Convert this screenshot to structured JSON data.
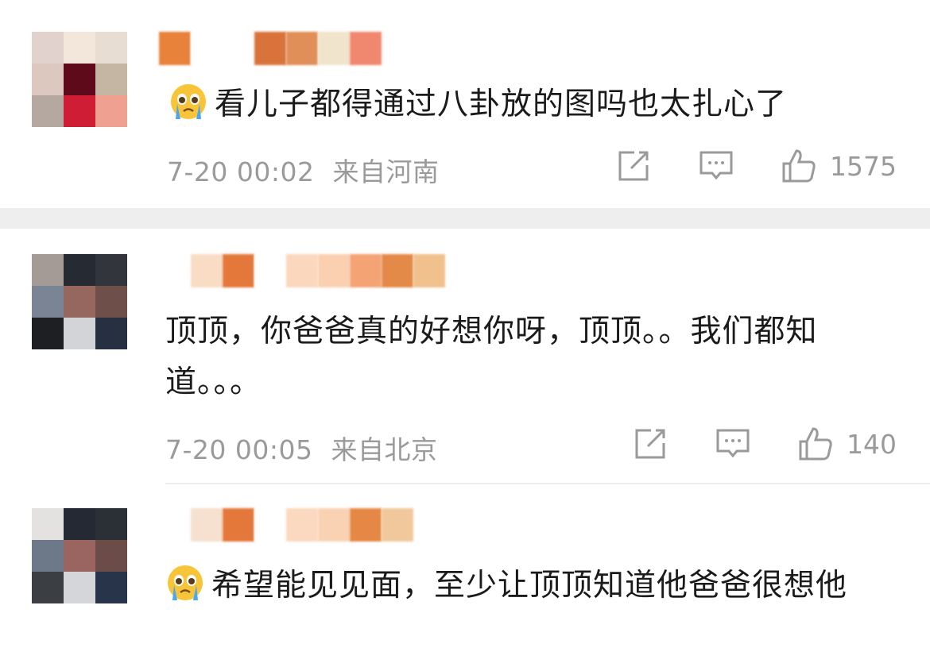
{
  "comments": [
    {
      "text": "看儿子都得通过八卦放的图吗也太扎心了",
      "has_emoji": true,
      "emoji_icon": "crying-face-icon",
      "time": "7-20 00:02",
      "location": "来自河南",
      "likes": "1575",
      "avatar_colors": [
        "#e2d2cd",
        "#f3e7dc",
        "#e8ddd2",
        "#dcc8bf",
        "#5e0a1a",
        "#c4b6a3",
        "#b4a8a0",
        "#cf1d36",
        "#f0a090"
      ],
      "name_blocks": [
        "#e8823a",
        "#ffffff",
        "#ffffff",
        "#d9733c",
        "#e08f58",
        "#f1e4cc",
        "#f08870"
      ]
    },
    {
      "text": "顶顶，你爸爸真的好想你呀，顶顶。。我们都知道。。。",
      "has_emoji": false,
      "time": "7-20 00:05",
      "location": "来自北京",
      "likes": "140",
      "avatar_colors": [
        "#a59b96",
        "#262a33",
        "#33353c",
        "#7b8494",
        "#95675e",
        "#6e4f4a",
        "#1d1f22",
        "#d3d4d8",
        "#263040"
      ],
      "name_blocks": [
        "#f9dcc4",
        "#e4783a",
        "#ffffff",
        "#fbd7bd",
        "#fad0b1",
        "#f4a374",
        "#e48a48",
        "#f0c18c"
      ]
    },
    {
      "text": "希望能见见面，至少让顶顶知道他爸爸很想他",
      "has_emoji": true,
      "emoji_icon": "crying-face-icon",
      "avatar_colors": [
        "#e4e2e0",
        "#242934",
        "#2b2f36",
        "#6d7889",
        "#9a6560",
        "#6c4c49",
        "#3b3f44",
        "#d5d6d9",
        "#27344a"
      ],
      "name_blocks": [
        "#f6e0cf",
        "#e4783a",
        "#ffffff",
        "#fbd9c0",
        "#f9d2b4",
        "#e58845",
        "#f1c89c"
      ]
    }
  ],
  "colors": {
    "meta_gray": "#9a9a9a",
    "band": "#eeeeee",
    "text": "#1b1b1b"
  },
  "icons": {
    "share": "share-icon",
    "comment": "comment-icon",
    "like": "like-icon"
  }
}
